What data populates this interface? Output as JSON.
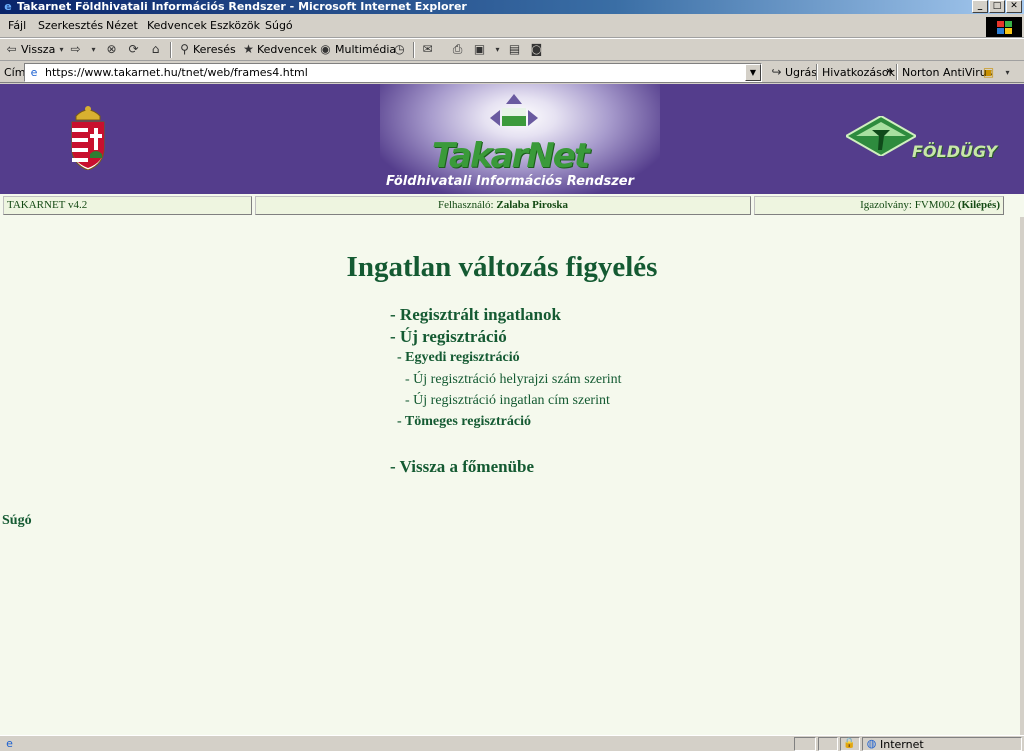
{
  "window": {
    "title": "Takarnet Földhivatali Információs Rendszer - Microsoft Internet Explorer",
    "buttons": {
      "minimize": "_",
      "maximize": "□",
      "close": "✕"
    }
  },
  "menu": [
    "Fájl",
    "Szerkesztés",
    "Nézet",
    "Kedvencek",
    "Eszközök",
    "Súgó"
  ],
  "toolbar": {
    "back": "Vissza",
    "search": "Keresés",
    "favorites": "Kedvencek",
    "media": "Multimédia"
  },
  "address": {
    "label": "Cím",
    "url": "https://www.takarnet.hu/tnet/web/frames4.html",
    "go": "Ugrás",
    "links": "Hivatkozások",
    "norton": "Norton AntiVirus"
  },
  "banner": {
    "logo_text": "TakarNet",
    "subtitle": "Földhivatali Információs Rendszer",
    "right_logo_text": "FÖLDÜGY"
  },
  "infobar": {
    "version": "TAKARNET v4.2",
    "user_label": "Felhasználó: ",
    "user_name": "Zalaba Piroska",
    "id_label": "Igazolvány: FVM002 ",
    "logout": "(Kilépés)"
  },
  "main": {
    "heading": "Ingatlan változás figyelés",
    "links": {
      "registered": "- Regisztrált ingatlanok",
      "new_registration": "- Új regisztráció",
      "single_registration": "- Egyedi regisztráció",
      "by_parcel_number": "- Új regisztráció helyrajzi szám szerint",
      "by_address": "- Új regisztráció ingatlan cím szerint",
      "bulk_registration": "- Tömeges regisztráció",
      "back_to_main": "- Vissza a főmenübe"
    },
    "help": "Súgó"
  },
  "status": {
    "zone": "Internet"
  },
  "colors": {
    "banner": "#543d8c",
    "page_bg": "#f5f9ed",
    "link_green": "#145a32"
  }
}
